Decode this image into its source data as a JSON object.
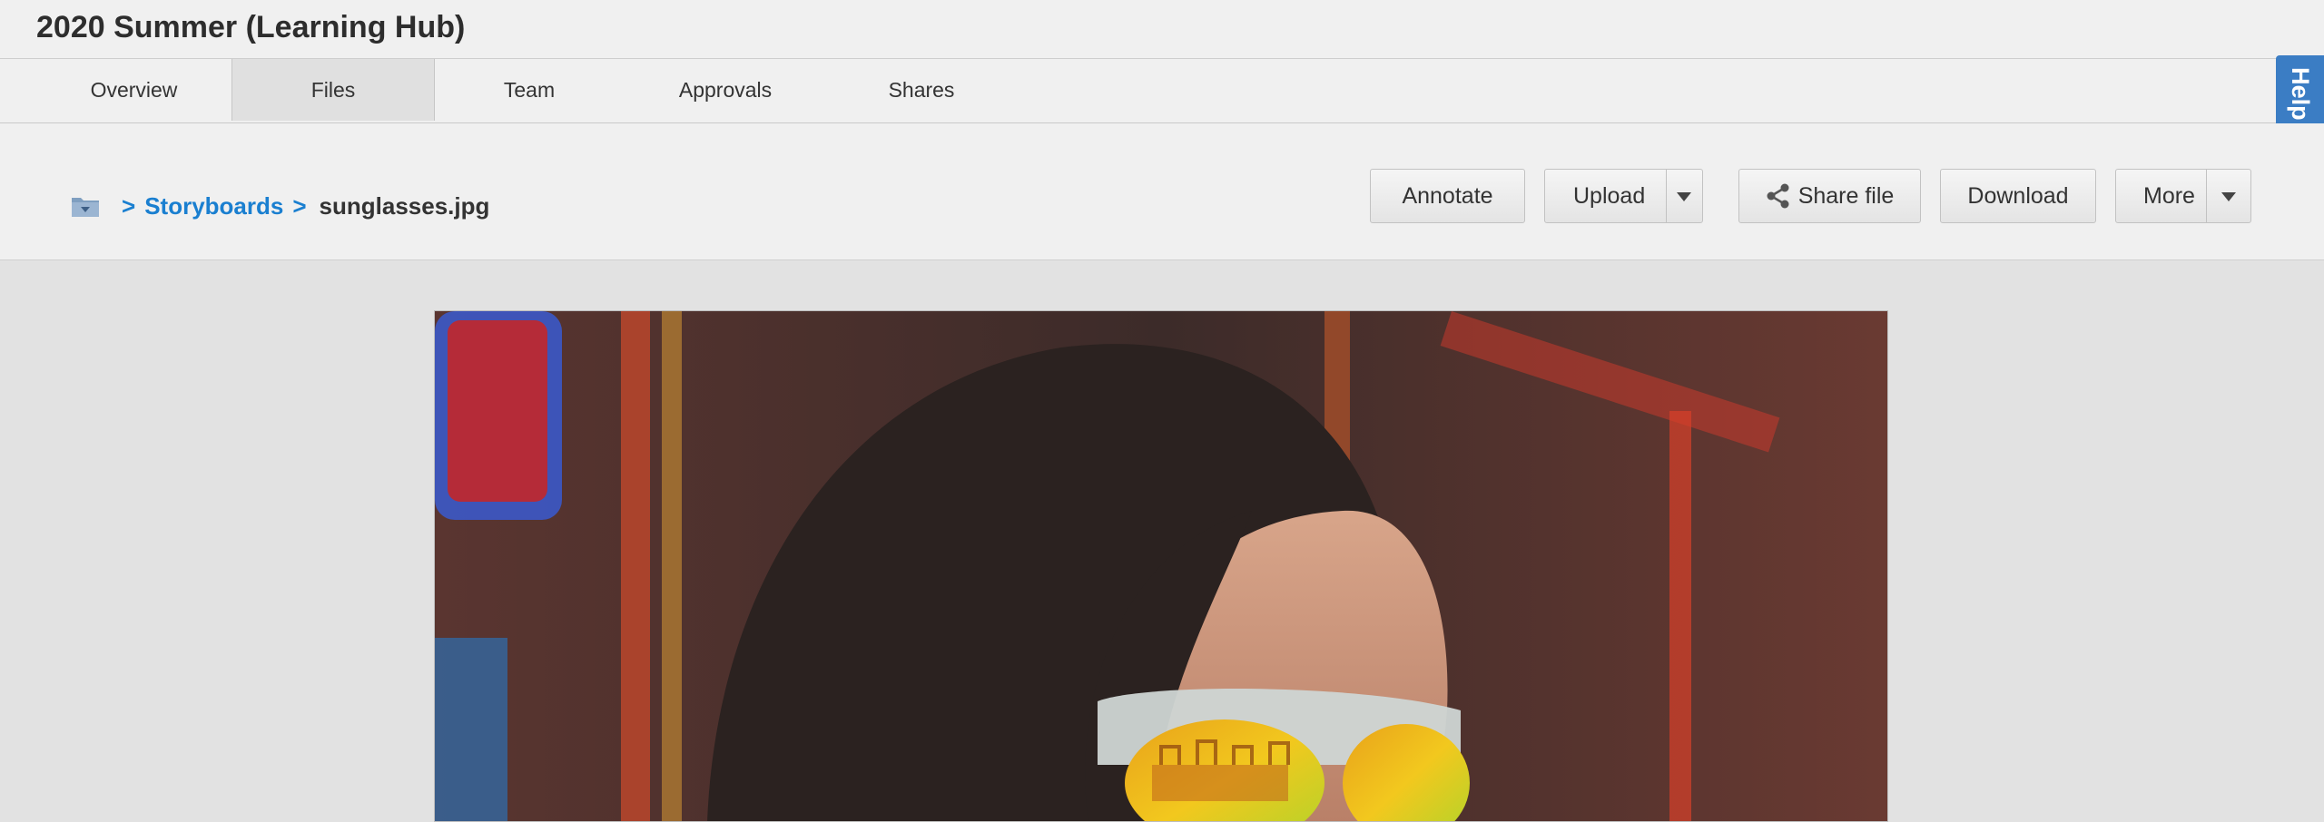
{
  "header": {
    "title": "2020 Summer (Learning Hub)"
  },
  "tabs": [
    {
      "label": "Overview",
      "active": false
    },
    {
      "label": "Files",
      "active": true
    },
    {
      "label": "Team",
      "active": false
    },
    {
      "label": "Approvals",
      "active": false
    },
    {
      "label": "Shares",
      "active": false
    }
  ],
  "breadcrumb": {
    "root_icon": "folder-icon",
    "separator": ">",
    "folder": "Storyboards",
    "current": "sunglasses.jpg"
  },
  "toolbar": {
    "annotate": "Annotate",
    "upload": "Upload",
    "share": "Share file",
    "download": "Download",
    "more": "More"
  },
  "help": {
    "label": "Help"
  },
  "colors": {
    "link": "#1a7fd0",
    "help_tab": "#3b7dc4",
    "active_tab": "#e0e0e0"
  },
  "preview": {
    "content": "photo of woman wearing mirrored sunglasses"
  }
}
